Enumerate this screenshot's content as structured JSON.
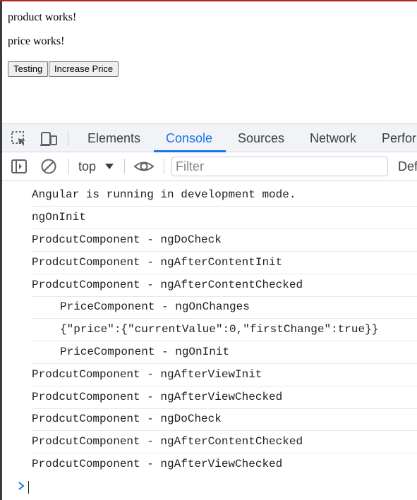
{
  "page": {
    "line1": "product works!",
    "line2": "price works!",
    "buttons": {
      "testing": "Testing",
      "increase_price": "Increase Price"
    }
  },
  "devtools": {
    "tabs": [
      "Elements",
      "Console",
      "Sources",
      "Network",
      "Perfor"
    ],
    "active_tab": "Console",
    "context": "top",
    "filter_placeholder": "Filter",
    "levels_partial": "Def",
    "colors": {
      "accent": "#1a73e8",
      "tabbar_bg": "#f1f3f6"
    },
    "icons": [
      "inspect-icon",
      "device-toggle-icon",
      "sidebar-toggle-icon",
      "clear-console-icon",
      "chevron-down-icon",
      "eye-icon",
      "prompt-chevron-icon"
    ]
  },
  "console_lines": [
    "Angular is running in development mode.",
    "ngOnInit",
    "ProdcutComponent - ngDoCheck",
    "ProdcutComponent - ngAfterContentInit",
    "ProdcutComponent - ngAfterContentChecked",
    "PriceComponent - ngOnChanges",
    "{\"price\":{\"currentValue\":0,\"firstChange\":true}}",
    "PriceComponent - ngOnInit",
    "ProdcutComponent - ngAfterViewInit",
    "ProdcutComponent - ngAfterViewChecked",
    "ProdcutComponent - ngDoCheck",
    "ProdcutComponent - ngAfterContentChecked",
    "ProdcutComponent - ngAfterViewChecked"
  ]
}
